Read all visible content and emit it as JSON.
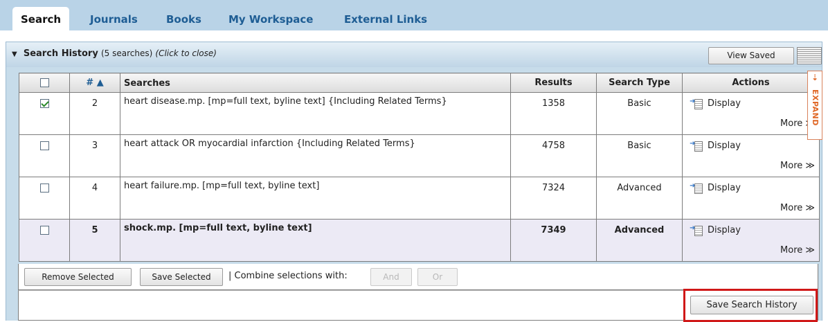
{
  "tabs": [
    {
      "label": "Search",
      "active": true
    },
    {
      "label": "Journals",
      "active": false
    },
    {
      "label": "Books",
      "active": false
    },
    {
      "label": "My Workspace",
      "active": false
    },
    {
      "label": "External Links",
      "active": false
    }
  ],
  "panel": {
    "title": "Search History",
    "count_text": "(5 searches)",
    "close_hint": "(Click to close)",
    "view_saved_label": "View Saved"
  },
  "table": {
    "headers": {
      "num": "# ▲",
      "searches": "Searches",
      "results": "Results",
      "search_type": "Search Type",
      "actions": "Actions"
    },
    "rows": [
      {
        "num": "2",
        "search": "heart disease.mp. [mp=full text, byline text] {Including Related Terms}",
        "results": "1358",
        "type": "Basic",
        "checked": true,
        "display": "Display",
        "more": "More ≫"
      },
      {
        "num": "3",
        "search": "heart attack OR myocardial infarction {Including Related Terms}",
        "results": "4758",
        "type": "Basic",
        "checked": false,
        "display": "Display",
        "more": "More ≫"
      },
      {
        "num": "4",
        "search": "heart failure.mp. [mp=full text, byline text]",
        "results": "7324",
        "type": "Advanced",
        "checked": false,
        "display": "Display",
        "more": "More ≫"
      },
      {
        "num": "5",
        "search": "shock.mp. [mp=full text, byline text]",
        "results": "7349",
        "type": "Advanced",
        "checked": false,
        "display": "Display",
        "more": "More ≫"
      }
    ]
  },
  "expand_label": "EXPAND",
  "actions": {
    "remove_selected": "Remove Selected",
    "save_selected": "Save Selected",
    "combine_label": "| Combine selections with:",
    "and_label": "And",
    "or_label": "Or",
    "save_history": "Save Search History"
  },
  "colors": {
    "tab_bar": "#b9d3e7",
    "link_blue": "#1e5d94",
    "highlight_red": "#d01818",
    "expand_orange": "#e06a2a"
  }
}
